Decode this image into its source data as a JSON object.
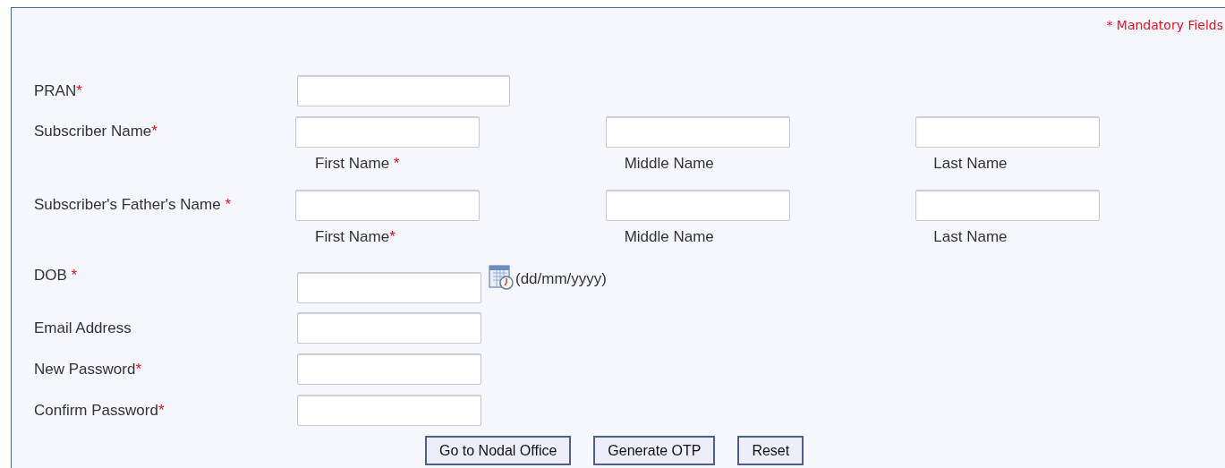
{
  "mandatory_note": "* Mandatory Fields",
  "fields": [
    {
      "kind": "single",
      "label": "PRAN",
      "mark": "*"
    },
    {
      "kind": "name",
      "label": "Subscriber Name",
      "mark": "*",
      "parts": [
        {
          "label": "First Name",
          "mark": " *"
        },
        {
          "label": "Middle Name"
        },
        {
          "label": "Last Name"
        }
      ]
    },
    {
      "kind": "name",
      "label": "Subscriber's Father's Name",
      "mark": " *",
      "parts": [
        {
          "label": "First Name",
          "mark": "*"
        },
        {
          "label": "Middle Name"
        },
        {
          "label": "Last Name"
        }
      ]
    },
    {
      "kind": "date",
      "label": "DOB",
      "mark": " *",
      "hint": "(dd/mm/yyyy)"
    },
    {
      "kind": "text",
      "label": "Email Address"
    },
    {
      "kind": "text",
      "label": "New Password",
      "mark": "*"
    },
    {
      "kind": "text",
      "label": "Confirm Password",
      "mark": "*"
    }
  ],
  "buttons": [
    "Go to Nodal Office",
    "Generate OTP",
    "Reset"
  ]
}
